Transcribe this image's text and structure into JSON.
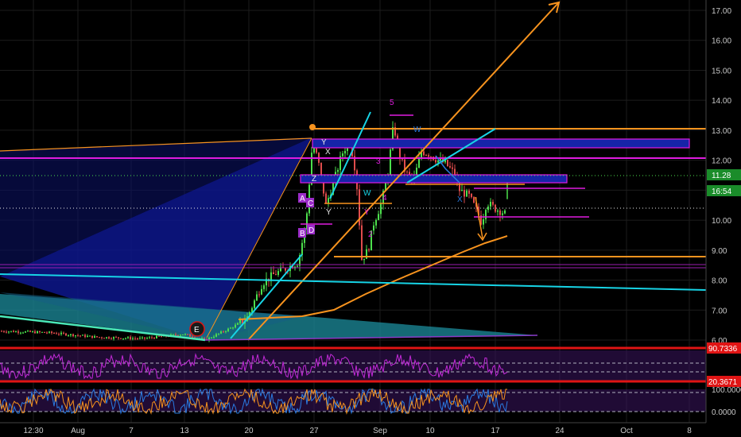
{
  "chart_data": {
    "type": "candlestick",
    "y_axis": {
      "ticks": [
        "6.00",
        "7.00",
        "8.00",
        "9.00",
        "10.00",
        "11.00",
        "12.00",
        "13.00",
        "14.00",
        "15.00",
        "16.00",
        "17.00"
      ],
      "range": [
        5.6,
        17.4
      ]
    },
    "x_axis": {
      "ticks": [
        "12:30",
        "Aug",
        "7",
        "13",
        "20",
        "27",
        "Sep",
        "10",
        "17",
        "24",
        "Oct",
        "8"
      ]
    },
    "price_tags": {
      "last_price": "11.28",
      "countdown": "16:54",
      "last_price_value": 10.2
    },
    "wave_labels": [
      "5",
      "W",
      "Y",
      "X",
      "Y",
      "W",
      "X",
      "Y",
      "Z",
      "2",
      "4",
      "3",
      "A",
      "C",
      "B",
      "D"
    ],
    "event_marker": "E",
    "oscillator_1": {
      "upper_tag": "90.7336",
      "lower_tag": "20.3671"
    },
    "oscillator_2": {
      "tag": "100.0000",
      "ticks": [
        "100.0000",
        "0.0000"
      ]
    },
    "colors": {
      "background": "#000000",
      "magenta": "#e01ce0",
      "orange": "#f7931e",
      "cyan": "#17d4e6",
      "red": "#e01414",
      "blue_fill": "#1624a8",
      "green_candle": "#4ce04c",
      "red_candle": "#e04c4c"
    }
  }
}
